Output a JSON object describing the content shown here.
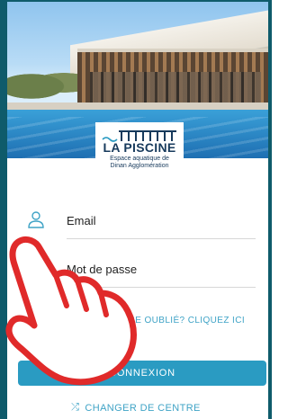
{
  "logo": {
    "title": "LA PISCINE",
    "subtitle_line1": "Espace aquatique de",
    "subtitle_line2": "Dinan Agglomération"
  },
  "form": {
    "email_label": "Email",
    "password_label": "Mot de passe",
    "forgot_link": "MOT DE PASSE OUBLIÉ? CLIQUEZ ICI",
    "connect_button": "CONNEXION",
    "change_centre": "CHANGER DE CENTRE"
  },
  "icons": {
    "user": "user-icon",
    "shuffle": "shuffle-icon",
    "hand": "pointing-hand-icon"
  },
  "colors": {
    "accent": "#2a9bc2",
    "link": "#3fa3c6",
    "frame": "#0f5b6b",
    "logo": "#173a5c",
    "hand_outline": "#e02a2a"
  }
}
